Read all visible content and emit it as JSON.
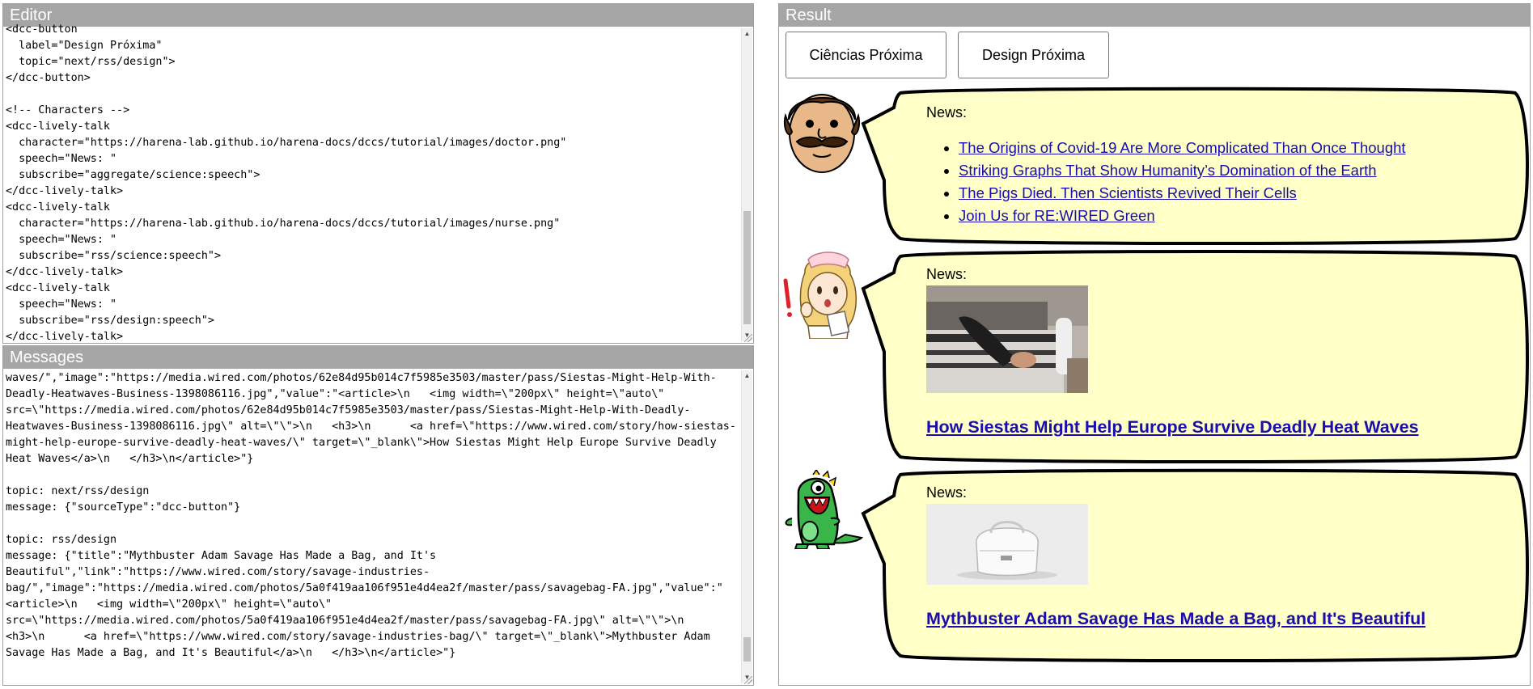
{
  "editor": {
    "title": "Editor",
    "lines": [
      "<dcc-button",
      "  label=\"Design Próxima\"",
      "  topic=\"next/rss/design\">",
      "</dcc-button>",
      "",
      "<!-- Characters -->",
      "<dcc-lively-talk",
      "  character=\"https://harena-lab.github.io/harena-docs/dccs/tutorial/images/doctor.png\"",
      "  speech=\"News: \"",
      "  subscribe=\"aggregate/science:speech\">",
      "</dcc-lively-talk>",
      "<dcc-lively-talk",
      "  character=\"https://harena-lab.github.io/harena-docs/dccs/tutorial/images/nurse.png\"",
      "  speech=\"News: \"",
      "  subscribe=\"rss/science:speech\">",
      "</dcc-lively-talk>",
      "<dcc-lively-talk",
      "  speech=\"News: \"",
      "  subscribe=\"rss/design:speech\">",
      "</dcc-lively-talk>"
    ]
  },
  "messages": {
    "title": "Messages",
    "lines": [
      "waves/\",\"image\":\"https://media.wired.com/photos/62e84d95b014c7f5985e3503/master/pass/Siestas-Might-Help-With-",
      "Deadly-Heatwaves-Business-1398086116.jpg\",\"value\":\"<article>\\n   <img width=\\\"200px\\\" height=\\\"auto\\\"",
      "src=\\\"https://media.wired.com/photos/62e84d95b014c7f5985e3503/master/pass/Siestas-Might-Help-With-Deadly-",
      "Heatwaves-Business-1398086116.jpg\\\" alt=\\\"\\\">\\n   <h3>\\n      <a href=\\\"https://www.wired.com/story/how-siestas-",
      "might-help-europe-survive-deadly-heat-waves/\\\" target=\\\"_blank\\\">How Siestas Might Help Europe Survive Deadly",
      "Heat Waves</a>\\n   </h3>\\n</article>\"}",
      "",
      "topic: next/rss/design",
      "message: {\"sourceType\":\"dcc-button\"}",
      "",
      "topic: rss/design",
      "message: {\"title\":\"Mythbuster Adam Savage Has Made a Bag, and It's",
      "Beautiful\",\"link\":\"https://www.wired.com/story/savage-industries-",
      "bag/\",\"image\":\"https://media.wired.com/photos/5a0f419aa106f951e4d4ea2f/master/pass/savagebag-FA.jpg\",\"value\":\"",
      "<article>\\n   <img width=\\\"200px\\\" height=\\\"auto\\\"",
      "src=\\\"https://media.wired.com/photos/5a0f419aa106f951e4d4ea2f/master/pass/savagebag-FA.jpg\\\" alt=\\\"\\\">\\n",
      "<h3>\\n      <a href=\\\"https://www.wired.com/story/savage-industries-bag/\\\" target=\\\"_blank\\\">Mythbuster Adam",
      "Savage Has Made a Bag, and It's Beautiful</a>\\n   </h3>\\n</article>\"}"
    ]
  },
  "result": {
    "title": "Result",
    "buttons": {
      "science": "Ciências Próxima",
      "design": "Design Próxima"
    },
    "doctor": {
      "speech": "News:",
      "links": [
        "The Origins of Covid-19 Are More Complicated Than Once Thought",
        "Striking Graphs That Show Humanity’s Domination of the Earth",
        "The Pigs Died. Then Scientists Revived Their Cells",
        "Join Us for RE:WIRED Green"
      ]
    },
    "nurse": {
      "speech": "News:",
      "headline": "How Siestas Might Help Europe Survive Deadly Heat Waves"
    },
    "monster": {
      "speech": "News:",
      "headline": "Mythbuster Adam Savage Has Made a Bag, and It's Beautiful"
    },
    "colors": {
      "bubble_fill": "#ffffc8",
      "link": "#1a0dab",
      "title_bar": "#a6a6a6"
    }
  }
}
